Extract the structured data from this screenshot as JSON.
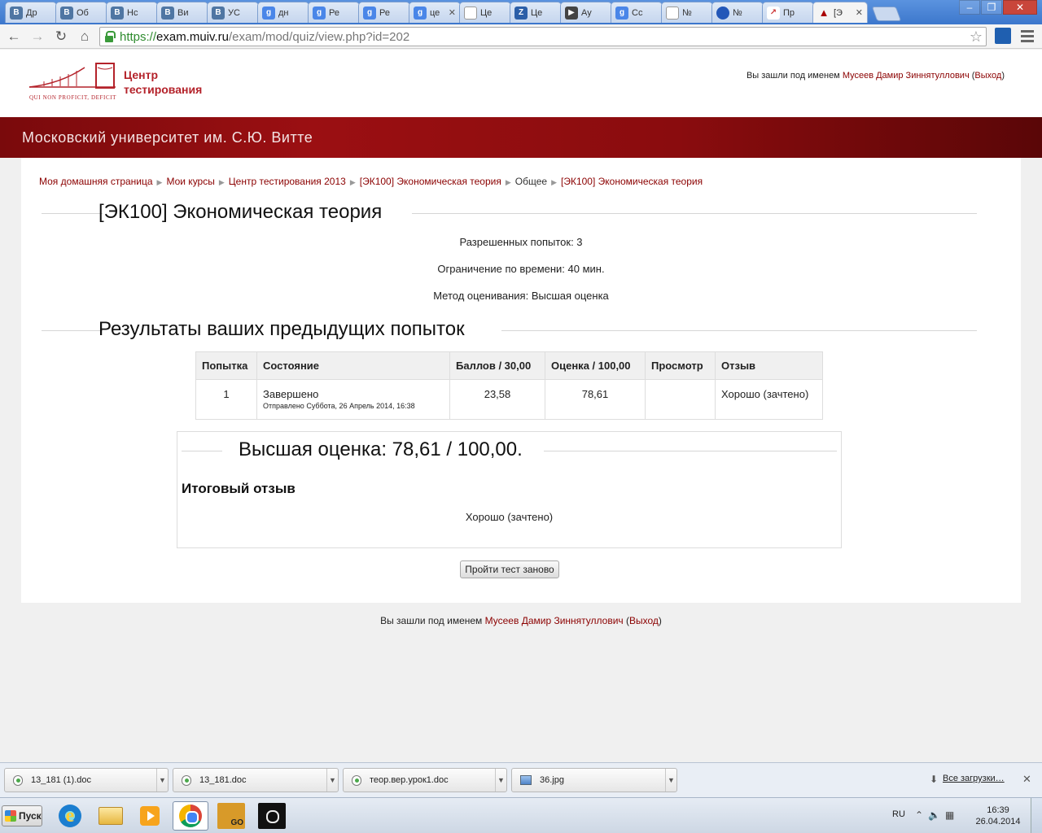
{
  "browser": {
    "tabs": [
      {
        "label": "Др",
        "icon": "vk"
      },
      {
        "label": "Об",
        "icon": "vk"
      },
      {
        "label": "Нс",
        "icon": "vk"
      },
      {
        "label": "Ви",
        "icon": "vk"
      },
      {
        "label": "УС",
        "icon": "vk"
      },
      {
        "label": "дн",
        "icon": "gs"
      },
      {
        "label": "Ре",
        "icon": "gs"
      },
      {
        "label": "Ре",
        "icon": "gs"
      },
      {
        "label": "це",
        "icon": "gs"
      },
      {
        "label": "Це",
        "icon": "doc"
      },
      {
        "label": "Це",
        "icon": "z"
      },
      {
        "label": "Ау",
        "icon": "play"
      },
      {
        "label": "Сс",
        "icon": "gs"
      },
      {
        "label": "№",
        "icon": "doc"
      },
      {
        "label": "№",
        "icon": "circle"
      },
      {
        "label": "Пр",
        "icon": "chart"
      },
      {
        "label": "[Э",
        "icon": "hat"
      }
    ],
    "url": {
      "scheme": "https://",
      "host": "exam.muiv.ru",
      "path": "/exam/mod/quiz/view.php?id=202"
    }
  },
  "header": {
    "logo_line1": "Центр",
    "logo_line2": "тестирования",
    "logo_motto": "QUI NON PROFICIT, DEFICIT",
    "login_prefix": "Вы зашли под именем ",
    "user_name": "Мусеев Дамир Зиннятуллович",
    "logout_label": "Выход",
    "banner_title": "Московский университет им. С.Ю. Витте"
  },
  "breadcrumb": [
    "Моя домашняя страница",
    "Мои курсы",
    "Центр тестирования 2013",
    "[ЭК100] Экономическая теория",
    "Общее",
    "[ЭК100] Экономическая теория"
  ],
  "quiz": {
    "title": "[ЭК100] Экономическая теория",
    "attempts_allowed": "Разрешенных попыток: 3",
    "time_limit": "Ограничение по времени: 40 мин.",
    "grading_method": "Метод оценивания: Высшая оценка",
    "results_title": "Результаты ваших предыдущих попыток",
    "table": {
      "headers": [
        "Попытка",
        "Состояние",
        "Баллов / 30,00",
        "Оценка / 100,00",
        "Просмотр",
        "Отзыв"
      ],
      "rows": [
        {
          "attempt": "1",
          "state": "Завершено",
          "submitted": "Отправлено Суббота, 26 Апрель 2014, 16:38",
          "marks": "23,58",
          "grade": "78,61",
          "review": "",
          "feedback": "Хорошо (зачтено)"
        }
      ]
    },
    "highest_grade": "Высшая оценка: 78,61 / 100,00.",
    "overall_feedback_title": "Итоговый отзыв",
    "overall_feedback": "Хорошо (зачтено)",
    "retry_label": "Пройти тест заново"
  },
  "downloads": {
    "items": [
      "13_181 (1).doc",
      "13_181.doc",
      "теор.вер.урок1.doc",
      "36.jpg"
    ],
    "all_label": "Все загрузки…"
  },
  "taskbar": {
    "start_label": "Пуск",
    "lang": "RU",
    "time": "16:39",
    "date": "26.04.2014",
    "csgo_label": "GO"
  }
}
